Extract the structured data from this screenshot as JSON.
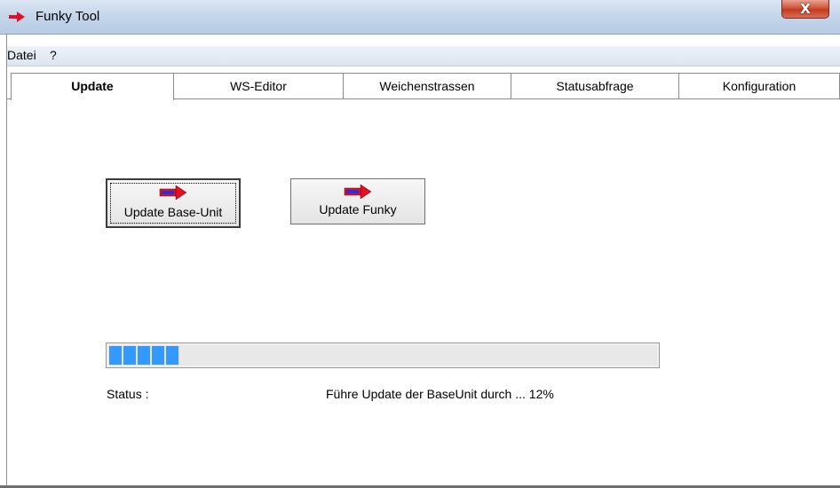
{
  "window": {
    "title": "Funky Tool",
    "close_symbol": "X"
  },
  "menu": {
    "items": [
      "Datei",
      "?"
    ]
  },
  "tabs": [
    "Update",
    "WS-Editor",
    "Weichenstrassen",
    "Statusabfrage",
    "Konfiguration"
  ],
  "active_tab": "Update",
  "buttons": {
    "update_base_unit": "Update Base-Unit",
    "update_funky": "Update Funky"
  },
  "progress": {
    "percent": 12,
    "segments_filled": 5
  },
  "status": {
    "label": "Status :",
    "message": "Führe Update der BaseUnit durch ... 12%"
  },
  "colors": {
    "progress_fill": "#3399ff",
    "close_button": "#c43a1e",
    "title_gradient": "#c4d5ea"
  },
  "icons": {
    "app": "red-arrow-icon",
    "button": "firmware-arrow-icon"
  }
}
